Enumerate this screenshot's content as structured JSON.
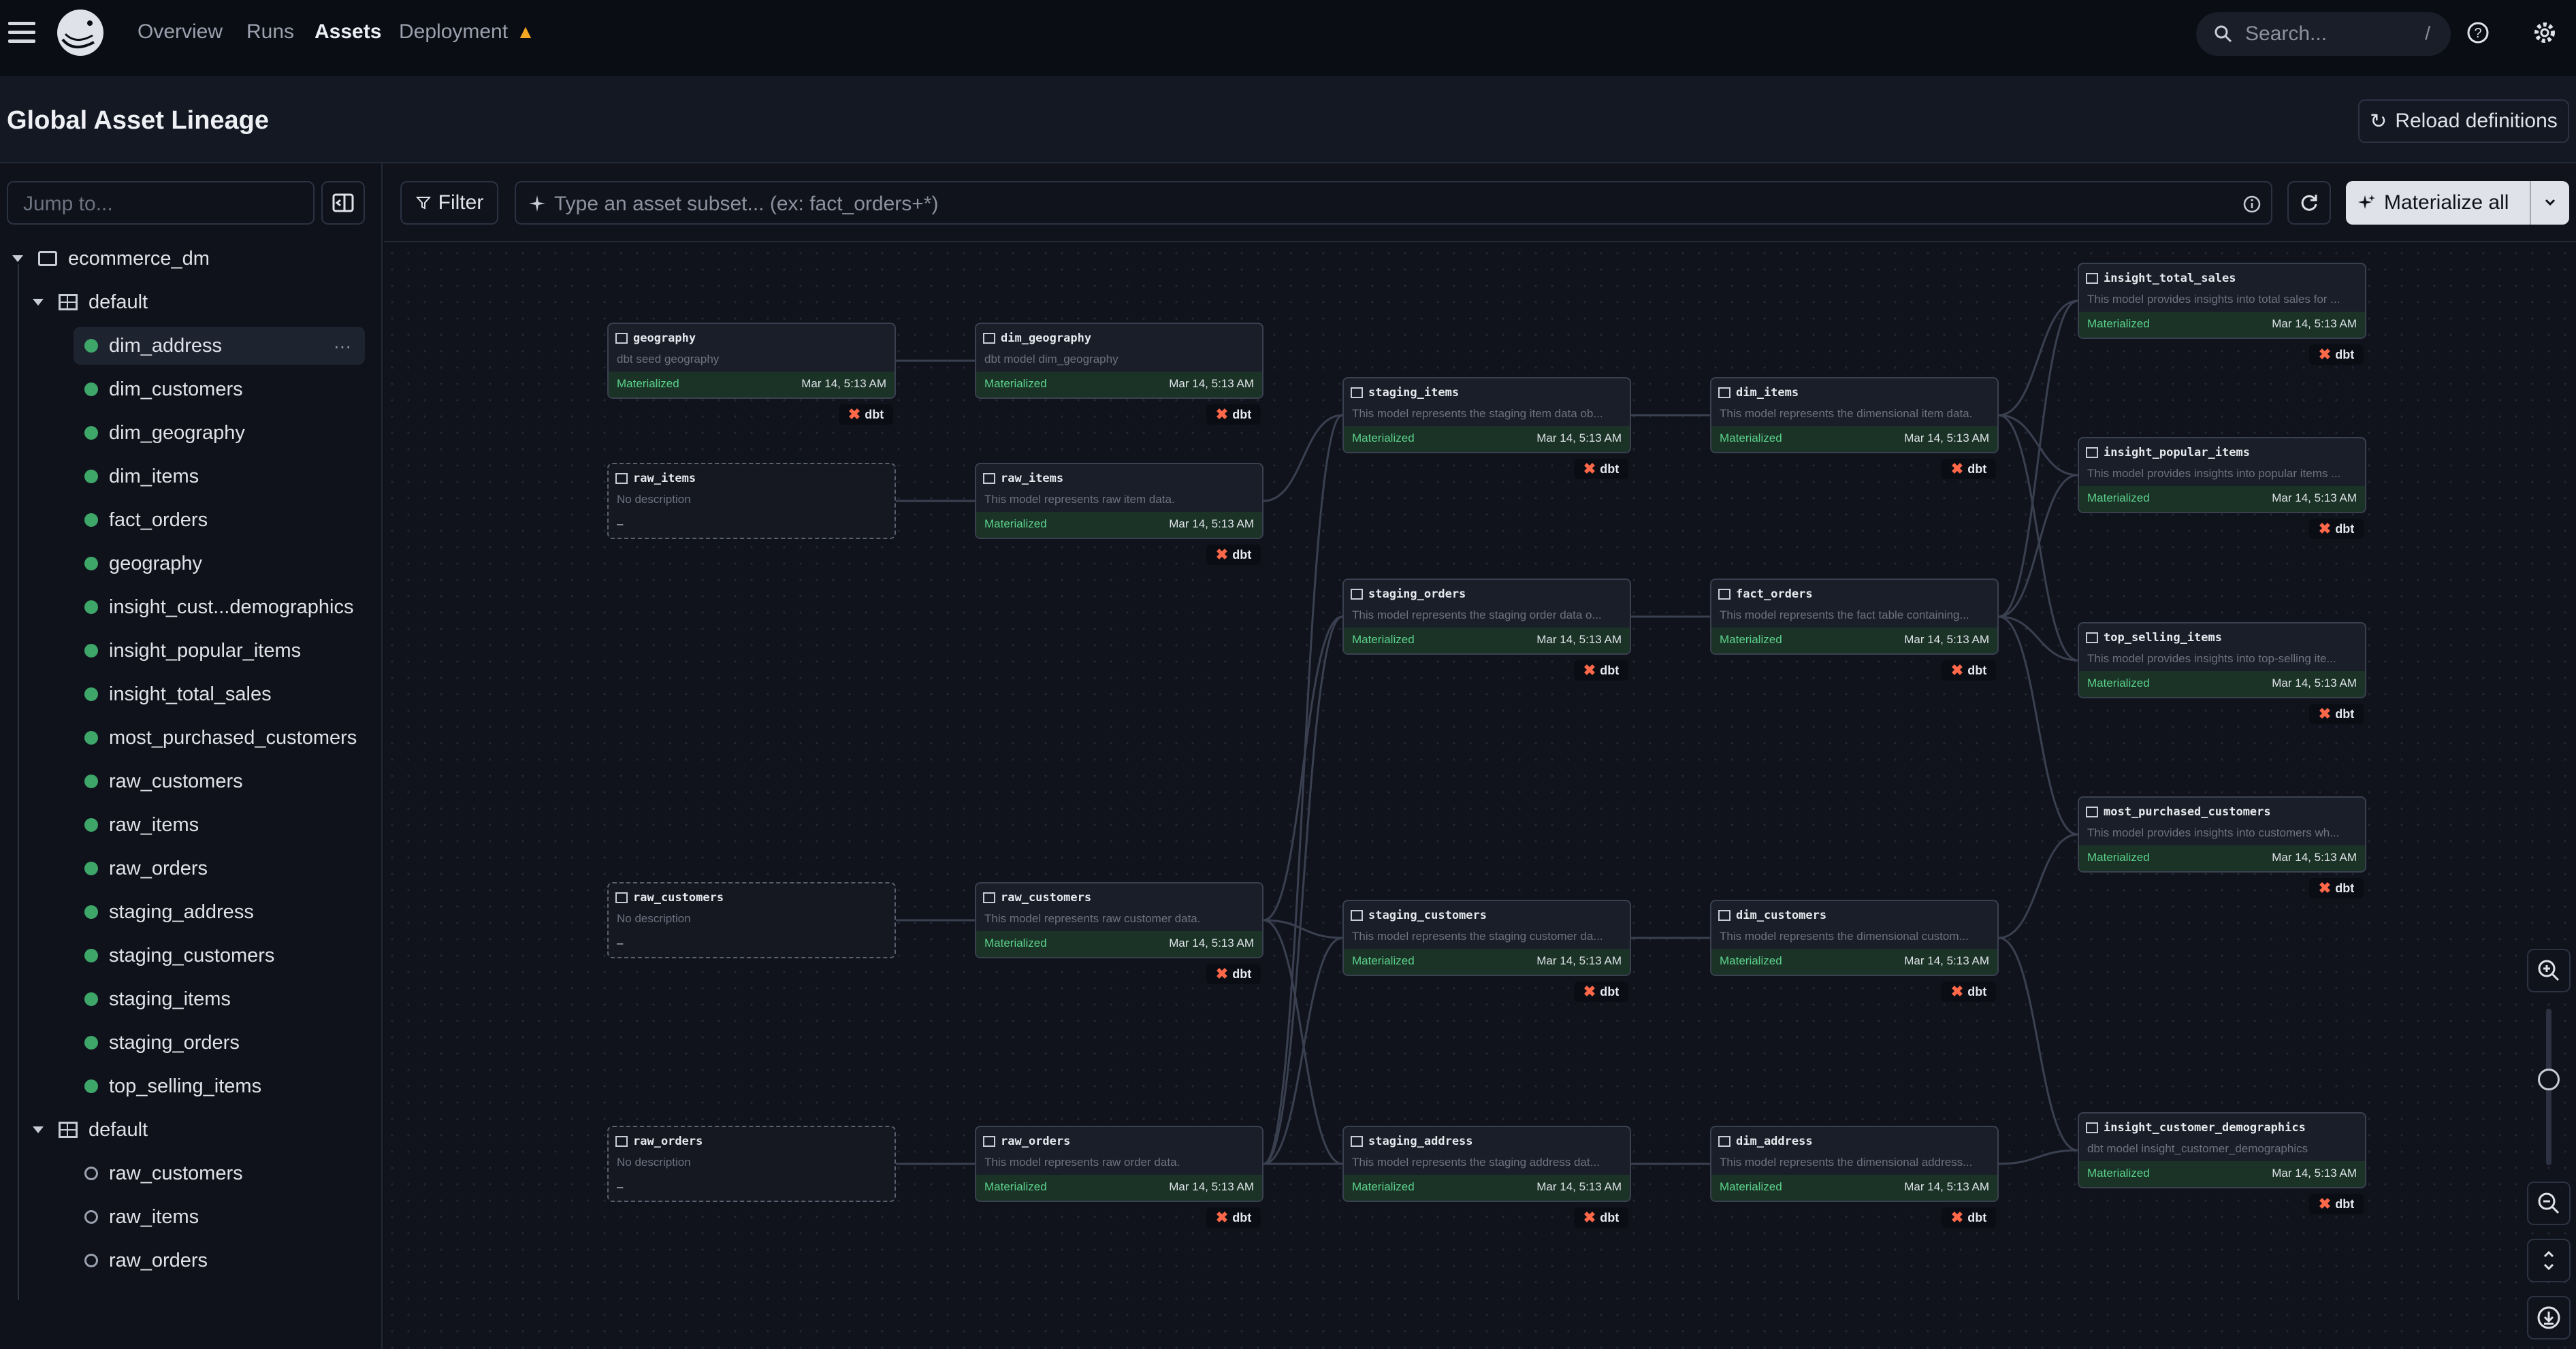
{
  "nav": {
    "items": [
      "Overview",
      "Runs",
      "Assets",
      "Deployment"
    ],
    "active": "Assets",
    "search_placeholder": "Search...",
    "search_shortcut": "/"
  },
  "header": {
    "title": "Global Asset Lineage",
    "reload_label": "Reload definitions"
  },
  "sidebar": {
    "jump_placeholder": "Jump to...",
    "root": "ecommerce_dm",
    "groups": [
      {
        "name": "default",
        "assets": [
          "dim_address",
          "dim_customers",
          "dim_geography",
          "dim_items",
          "fact_orders",
          "geography",
          "insight_cust...demographics",
          "insight_popular_items",
          "insight_total_sales",
          "most_purchased_customers",
          "raw_customers",
          "raw_items",
          "raw_orders",
          "staging_address",
          "staging_customers",
          "staging_items",
          "staging_orders",
          "top_selling_items"
        ]
      },
      {
        "name": "default",
        "assets": [
          "raw_customers",
          "raw_items",
          "raw_orders"
        ]
      }
    ]
  },
  "toolbar": {
    "filter_label": "Filter",
    "subset_placeholder": "Type an asset subset... (ex: fact_orders+*)",
    "materialize_label": "Materialize all"
  },
  "graph": {
    "kind_label": "dbt",
    "nodes": [
      {
        "name": "geography",
        "desc": "dbt seed geography",
        "status": "Materialized",
        "time": "Mar 14, 5:13 AM",
        "source": false
      },
      {
        "name": "dim_geography",
        "desc": "dbt model dim_geography",
        "status": "Materialized",
        "time": "Mar 14, 5:13 AM",
        "source": false
      },
      {
        "name": "raw_items",
        "desc": "No description",
        "status": "–",
        "time": "",
        "source": true
      },
      {
        "name": "raw_items",
        "desc": "This model represents raw item data.",
        "status": "Materialized",
        "time": "Mar 14, 5:13 AM",
        "source": false
      },
      {
        "name": "raw_customers",
        "desc": "No description",
        "status": "–",
        "time": "",
        "source": true
      },
      {
        "name": "raw_customers",
        "desc": "This model represents raw customer data.",
        "status": "Materialized",
        "time": "Mar 14, 5:13 AM",
        "source": false
      },
      {
        "name": "raw_orders",
        "desc": "No description",
        "status": "–",
        "time": "",
        "source": true
      },
      {
        "name": "raw_orders",
        "desc": "This model represents raw order data.",
        "status": "Materialized",
        "time": "Mar 14, 5:13 AM",
        "source": false
      },
      {
        "name": "staging_items",
        "desc": "This model represents the staging item data ob...",
        "status": "Materialized",
        "time": "Mar 14, 5:13 AM",
        "source": false
      },
      {
        "name": "staging_orders",
        "desc": "This model represents the staging order data o...",
        "status": "Materialized",
        "time": "Mar 14, 5:13 AM",
        "source": false
      },
      {
        "name": "staging_customers",
        "desc": "This model represents the staging customer da...",
        "status": "Materialized",
        "time": "Mar 14, 5:13 AM",
        "source": false
      },
      {
        "name": "staging_address",
        "desc": "This model represents the staging address dat...",
        "status": "Materialized",
        "time": "Mar 14, 5:13 AM",
        "source": false
      },
      {
        "name": "dim_items",
        "desc": "This model represents the dimensional item data.",
        "status": "Materialized",
        "time": "Mar 14, 5:13 AM",
        "source": false
      },
      {
        "name": "fact_orders",
        "desc": "This model represents the fact table containing...",
        "status": "Materialized",
        "time": "Mar 14, 5:13 AM",
        "source": false
      },
      {
        "name": "dim_customers",
        "desc": "This model represents the dimensional custom...",
        "status": "Materialized",
        "time": "Mar 14, 5:13 AM",
        "source": false
      },
      {
        "name": "dim_address",
        "desc": "This model represents the dimensional address...",
        "status": "Materialized",
        "time": "Mar 14, 5:13 AM",
        "source": false
      },
      {
        "name": "insight_total_sales",
        "desc": "This model provides insights into total sales for ...",
        "status": "Materialized",
        "time": "Mar 14, 5:13 AM",
        "source": false
      },
      {
        "name": "insight_popular_items",
        "desc": "This model provides insights into popular items ...",
        "status": "Materialized",
        "time": "Mar 14, 5:13 AM",
        "source": false
      },
      {
        "name": "top_selling_items",
        "desc": "This model provides insights into top-selling ite...",
        "status": "Materialized",
        "time": "Mar 14, 5:13 AM",
        "source": false
      },
      {
        "name": "most_purchased_customers",
        "desc": "This model provides insights into customers wh...",
        "status": "Materialized",
        "time": "Mar 14, 5:13 AM",
        "source": false
      },
      {
        "name": "insight_customer_demographics",
        "desc": "dbt model insight_customer_demographics",
        "status": "Materialized",
        "time": "Mar 14, 5:13 AM",
        "source": false
      }
    ]
  }
}
